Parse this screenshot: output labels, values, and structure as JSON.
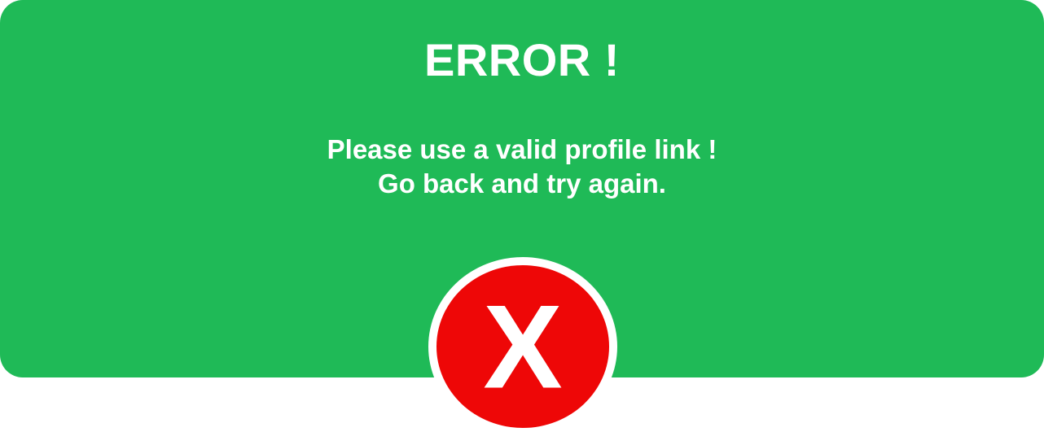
{
  "dialog": {
    "title": "ERROR !",
    "message_line1": "Please use a valid profile link !",
    "message_line2": "Go back and try again.",
    "icon": "close-x-icon",
    "badge_letter": "X"
  },
  "colors": {
    "banner": "#1fba57",
    "text": "#ffffff",
    "badge_fill": "#ee0707",
    "badge_ring": "#ffffff"
  }
}
